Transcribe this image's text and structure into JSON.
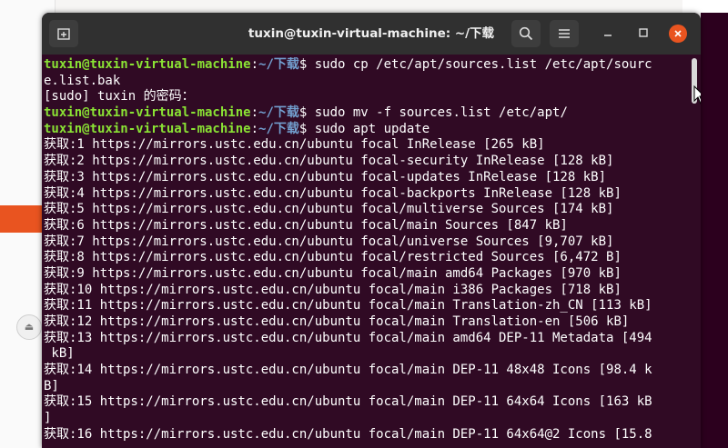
{
  "window": {
    "title": "tuxin@tuxin-virtual-machine: ~/下载"
  },
  "colors": {
    "terminal_bg": "#300a24",
    "prompt_user": "#8ae234",
    "prompt_path": "#729fcf",
    "close_button": "#e95420"
  },
  "icons": {
    "new_tab": "new-tab-icon",
    "search": "search-icon",
    "menu": "hamburger-menu-icon",
    "minimize": "minimize-icon",
    "maximize": "maximize-icon",
    "close": "close-icon"
  },
  "terminal": {
    "lines": [
      {
        "user": "tuxin@tuxin-virtual-machine",
        "sep": ":",
        "path": "~/下载",
        "text": "$ sudo cp /etc/apt/sources.list /etc/apt/sourc"
      },
      {
        "text": "e.list.bak"
      },
      {
        "text": "[sudo] tuxin 的密码："
      },
      {
        "user": "tuxin@tuxin-virtual-machine",
        "sep": ":",
        "path": "~/下载",
        "text": "$ sudo mv -f sources.list /etc/apt/"
      },
      {
        "user": "tuxin@tuxin-virtual-machine",
        "sep": ":",
        "path": "~/下载",
        "text": "$ sudo apt update"
      },
      {
        "text": "获取:1 https://mirrors.ustc.edu.cn/ubuntu focal InRelease [265 kB]"
      },
      {
        "text": "获取:2 https://mirrors.ustc.edu.cn/ubuntu focal-security InRelease [128 kB]"
      },
      {
        "text": "获取:3 https://mirrors.ustc.edu.cn/ubuntu focal-updates InRelease [128 kB]"
      },
      {
        "text": "获取:4 https://mirrors.ustc.edu.cn/ubuntu focal-backports InRelease [128 kB]"
      },
      {
        "text": "获取:5 https://mirrors.ustc.edu.cn/ubuntu focal/multiverse Sources [174 kB]"
      },
      {
        "text": "获取:6 https://mirrors.ustc.edu.cn/ubuntu focal/main Sources [847 kB]"
      },
      {
        "text": "获取:7 https://mirrors.ustc.edu.cn/ubuntu focal/universe Sources [9,707 kB]"
      },
      {
        "text": "获取:8 https://mirrors.ustc.edu.cn/ubuntu focal/restricted Sources [6,472 B]"
      },
      {
        "text": "获取:9 https://mirrors.ustc.edu.cn/ubuntu focal/main amd64 Packages [970 kB]"
      },
      {
        "text": "获取:10 https://mirrors.ustc.edu.cn/ubuntu focal/main i386 Packages [718 kB]"
      },
      {
        "text": "获取:11 https://mirrors.ustc.edu.cn/ubuntu focal/main Translation-zh_CN [113 kB]"
      },
      {
        "text": "获取:12 https://mirrors.ustc.edu.cn/ubuntu focal/main Translation-en [506 kB]"
      },
      {
        "text": "获取:13 https://mirrors.ustc.edu.cn/ubuntu focal/main amd64 DEP-11 Metadata [494"
      },
      {
        "text": " kB]"
      },
      {
        "text": "获取:14 https://mirrors.ustc.edu.cn/ubuntu focal/main DEP-11 48x48 Icons [98.4 k"
      },
      {
        "text": "B]"
      },
      {
        "text": "获取:15 https://mirrors.ustc.edu.cn/ubuntu focal/main DEP-11 64x64 Icons [163 kB"
      },
      {
        "text": "]"
      },
      {
        "text": "获取:16 https://mirrors.ustc.edu.cn/ubuntu focal/main DEP-11 64x64@2 Icons [15.8"
      }
    ]
  }
}
